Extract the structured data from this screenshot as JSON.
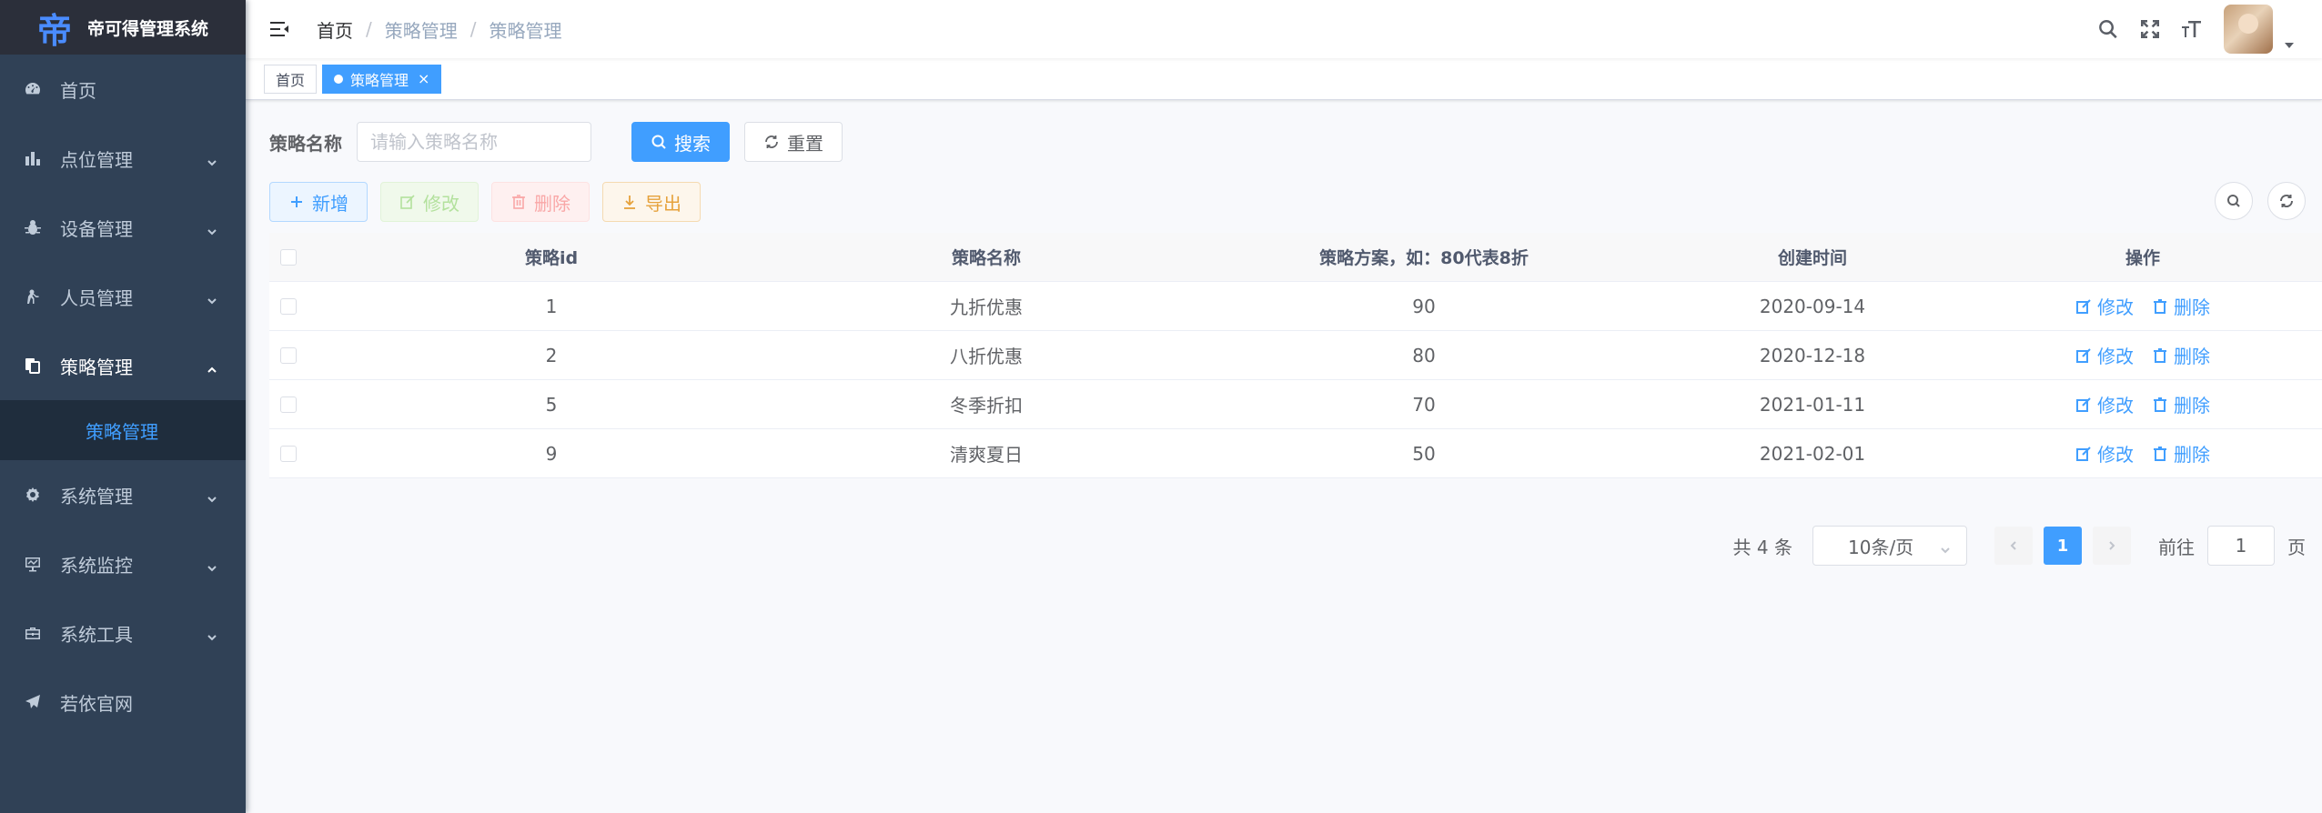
{
  "app": {
    "title": "帝可得管理系统",
    "logo_glyph": "帝"
  },
  "sidebar": {
    "items": [
      {
        "label": "首页",
        "icon": "dashboard-icon",
        "has_arrow": false
      },
      {
        "label": "点位管理",
        "icon": "bar-chart-icon",
        "has_arrow": true
      },
      {
        "label": "设备管理",
        "icon": "bug-icon",
        "has_arrow": true
      },
      {
        "label": "人员管理",
        "icon": "user-icon",
        "has_arrow": true
      },
      {
        "label": "策略管理",
        "icon": "documents-icon",
        "has_arrow": true,
        "open": true
      },
      {
        "label": "系统管理",
        "icon": "gear-icon",
        "has_arrow": true
      },
      {
        "label": "系统监控",
        "icon": "monitor-icon",
        "has_arrow": true
      },
      {
        "label": "系统工具",
        "icon": "toolbox-icon",
        "has_arrow": true
      },
      {
        "label": "若依官网",
        "icon": "paper-plane-icon",
        "has_arrow": false
      }
    ],
    "submenu": {
      "label": "策略管理"
    }
  },
  "navbar": {
    "breadcrumb": [
      "首页",
      "策略管理",
      "策略管理"
    ],
    "separator": "/"
  },
  "tags": [
    {
      "label": "首页",
      "active": false
    },
    {
      "label": "策略管理",
      "active": true,
      "close": "×"
    }
  ],
  "search": {
    "label": "策略名称",
    "placeholder": "请输入策略名称",
    "search_button": "搜索",
    "reset_button": "重置"
  },
  "toolbar": {
    "add": "新增",
    "edit": "修改",
    "delete": "删除",
    "export": "导出"
  },
  "table": {
    "headers": [
      "策略id",
      "策略名称",
      "策略方案，如：80代表8折",
      "创建时间",
      "操作"
    ],
    "rows": [
      {
        "id": "1",
        "name": "九折优惠",
        "discount": "90",
        "created": "2020-09-14"
      },
      {
        "id": "2",
        "name": "八折优惠",
        "discount": "80",
        "created": "2020-12-18"
      },
      {
        "id": "5",
        "name": "冬季折扣",
        "discount": "70",
        "created": "2021-01-11"
      },
      {
        "id": "9",
        "name": "清爽夏日",
        "discount": "50",
        "created": "2021-02-01"
      }
    ],
    "op_edit": "修改",
    "op_delete": "删除"
  },
  "pagination": {
    "total": "共 4 条",
    "page_size": "10条/页",
    "current_page": "1",
    "goto_label": "前往",
    "goto_value": "1",
    "page_unit": "页"
  },
  "colors": {
    "sidebar_bg": "#304156",
    "primary": "#409eff",
    "warning": "#e6a23c"
  }
}
